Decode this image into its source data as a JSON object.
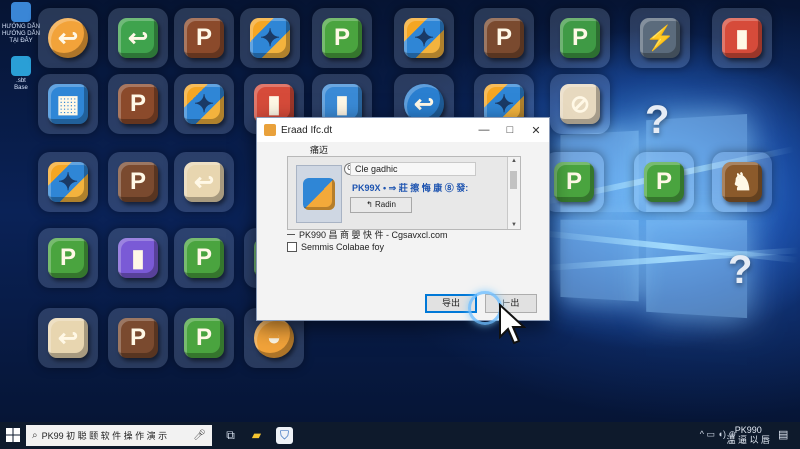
{
  "desktop": {
    "side_icons": [
      {
        "label": "HƯỚNG DẪN\nHƯỚNG DẪN\nTẠI ĐÂY",
        "color": "#3a86d6"
      },
      {
        "label": ".sbt\nBase",
        "color": "#2a9fd6"
      }
    ],
    "tile_rows": [
      [
        {
          "glyph": "↩",
          "bg": "#f2a33a",
          "shape": "round",
          "icon": "arrow-icon"
        },
        {
          "glyph": "↩",
          "bg": "#3fa34d",
          "shape": "cube",
          "icon": "arrow-icon"
        },
        {
          "glyph": "P",
          "bg": "#8b4a2b",
          "shape": "cube",
          "icon": "letter-p-icon"
        },
        {
          "glyph": "✦",
          "bg": "#2f86d6",
          "shape": "puzzle",
          "icon": "puzzle-icon"
        },
        {
          "glyph": "P",
          "bg": "#4aa43f",
          "shape": "cube",
          "icon": "letter-p-icon"
        },
        {
          "glyph": "✦",
          "bg": "#2f86d6",
          "shape": "puzzle",
          "icon": "puzzle-icon"
        },
        {
          "glyph": "P",
          "bg": "#7a4a2f",
          "shape": "cube",
          "icon": "letter-p-icon"
        },
        {
          "glyph": "P",
          "bg": "#3f9a45",
          "shape": "cube",
          "icon": "letter-p-icon"
        },
        {
          "glyph": "⚡",
          "bg": "#5b6b7c",
          "shape": "cube",
          "icon": "lightning-icon"
        },
        {
          "glyph": "▮",
          "bg": "#d64b3a",
          "shape": "cube",
          "icon": "square-icon"
        }
      ],
      [
        {
          "glyph": "▦",
          "bg": "#2f86d6",
          "shape": "cube",
          "icon": "grid-icon"
        },
        {
          "glyph": "P",
          "bg": "#8b4a2b",
          "shape": "cube",
          "icon": "letter-p-icon"
        },
        {
          "glyph": "✦",
          "bg": "#5ba63f",
          "shape": "puzzle",
          "icon": "puzzle-icon"
        },
        {
          "glyph": "▮",
          "bg": "#d64b3a",
          "shape": "cube",
          "icon": "square-icon"
        },
        {
          "glyph": "▮",
          "bg": "#3a8ad6",
          "shape": "cube",
          "icon": "square-icon"
        },
        {
          "glyph": "↩",
          "bg": "#2a7fd0",
          "shape": "round",
          "icon": "arrow-icon"
        },
        {
          "glyph": "✦",
          "bg": "#3f9a45",
          "shape": "puzzle",
          "icon": "puzzle-icon"
        },
        {
          "glyph": "⊘",
          "bg": "#e7d9bf",
          "shape": "cube",
          "icon": "no-icon"
        }
      ],
      [
        {
          "glyph": "✦",
          "bg": "#2f86d6",
          "shape": "puzzle",
          "icon": "puzzle-icon"
        },
        {
          "glyph": "P",
          "bg": "#7a4a2f",
          "shape": "cube",
          "icon": "letter-p-icon"
        },
        {
          "glyph": "↩",
          "bg": "#e8d6b0",
          "shape": "cube",
          "icon": "arrow-icon"
        },
        {
          "glyph": "P",
          "bg": "#4aa43f",
          "shape": "cube",
          "icon": "letter-p-icon"
        },
        {
          "glyph": "P",
          "bg": "#4aa43f",
          "shape": "cube",
          "icon": "letter-p-icon"
        },
        {
          "glyph": "♞",
          "bg": "#8b5a2b",
          "shape": "cube",
          "icon": "horse-icon"
        }
      ],
      [
        {
          "glyph": "P",
          "bg": "#4aa43f",
          "shape": "cube",
          "icon": "letter-p-icon"
        },
        {
          "glyph": "▮",
          "bg": "#7a5ad6",
          "shape": "cube",
          "icon": "square-icon"
        },
        {
          "glyph": "P",
          "bg": "#4aa43f",
          "shape": "cube",
          "icon": "letter-p-icon"
        },
        {
          "glyph": "P",
          "bg": "#3f9a45",
          "shape": "cube",
          "icon": "letter-p-icon"
        }
      ],
      [
        {
          "glyph": "↩",
          "bg": "#e8d6b0",
          "shape": "cube",
          "icon": "arrow-icon"
        },
        {
          "glyph": "P",
          "bg": "#7a4a2f",
          "shape": "cube",
          "icon": "letter-p-icon"
        },
        {
          "glyph": "P",
          "bg": "#4aa43f",
          "shape": "cube",
          "icon": "letter-p-icon"
        },
        {
          "glyph": "◒",
          "bg": "#f2a33a",
          "shape": "round",
          "icon": "circle-icon"
        }
      ]
    ],
    "question_marks": [
      "?",
      "?"
    ]
  },
  "dialog": {
    "title": "Eraad Ifc.dt",
    "panel_heading": "痛迈",
    "preview_line1": "Cle gadhic",
    "preview_line2": "PK99X • ⇒ 莊 擦 悔 康 ⑧ 發:",
    "preview_button": "↰ Radin",
    "row1": "PK990 昌 商 嬰 快 件 - Cgsavxcl.com",
    "row2": "Semmis Colabae foy",
    "button_primary": "导出",
    "button_secondary": "⊢出"
  },
  "taskbar": {
    "search_text": "PK99 初 聪 颐 软 件 操 作 演 示",
    "clock_line1": "PK990",
    "clock_line2": "温 逼 以 唇"
  },
  "colors": {
    "taskbar_bg": "#0e1a2c",
    "accent": "#0078d7"
  }
}
